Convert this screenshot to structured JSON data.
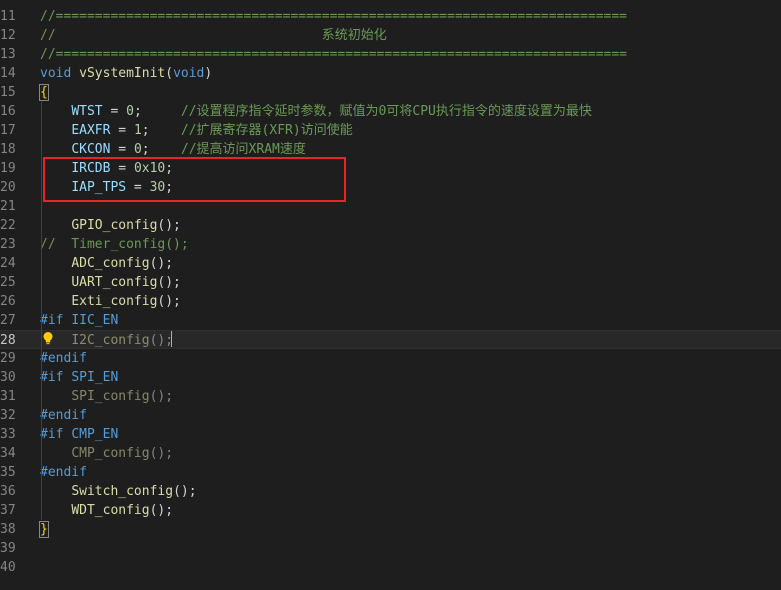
{
  "editor": {
    "highlight_color": "#e8242a",
    "lines": [
      {
        "no": "11",
        "segments": [
          {
            "t": "//=========================================================================",
            "c": "cmt"
          }
        ]
      },
      {
        "no": "12",
        "segments": [
          {
            "t": "//                                  系统初始化",
            "c": "cmt"
          }
        ]
      },
      {
        "no": "13",
        "segments": [
          {
            "t": "//=========================================================================",
            "c": "cmt"
          }
        ]
      },
      {
        "no": "14",
        "segments": [
          {
            "t": "void",
            "c": "kw"
          },
          {
            "t": " ",
            "c": "op"
          },
          {
            "t": "vSystemInit",
            "c": "fn"
          },
          {
            "t": "(",
            "c": "op"
          },
          {
            "t": "void",
            "c": "kw"
          },
          {
            "t": ")",
            "c": "op"
          }
        ]
      },
      {
        "no": "15",
        "segments": [
          {
            "t": "{",
            "c": "bracket"
          }
        ]
      },
      {
        "no": "16",
        "segments": [
          {
            "t": "    ",
            "c": "op"
          },
          {
            "t": "WTST",
            "c": "var"
          },
          {
            "t": " = ",
            "c": "op"
          },
          {
            "t": "0",
            "c": "num"
          },
          {
            "t": ";     ",
            "c": "op"
          },
          {
            "t": "//设置程序指令延时参数，赋值为0可将CPU执行指令的速度设置为最快",
            "c": "cmt"
          }
        ]
      },
      {
        "no": "17",
        "segments": [
          {
            "t": "    ",
            "c": "op"
          },
          {
            "t": "EAXFR",
            "c": "var"
          },
          {
            "t": " = ",
            "c": "op"
          },
          {
            "t": "1",
            "c": "num"
          },
          {
            "t": ";    ",
            "c": "op"
          },
          {
            "t": "//扩展寄存器(XFR)访问使能",
            "c": "cmt"
          }
        ]
      },
      {
        "no": "18",
        "segments": [
          {
            "t": "    ",
            "c": "op"
          },
          {
            "t": "CKCON",
            "c": "var"
          },
          {
            "t": " = ",
            "c": "op"
          },
          {
            "t": "0",
            "c": "num"
          },
          {
            "t": ";    ",
            "c": "op"
          },
          {
            "t": "//提高访问XRAM速度",
            "c": "cmt"
          }
        ]
      },
      {
        "no": "19",
        "segments": [
          {
            "t": "    ",
            "c": "op"
          },
          {
            "t": "IRCDB",
            "c": "var"
          },
          {
            "t": " = ",
            "c": "op"
          },
          {
            "t": "0x10",
            "c": "num"
          },
          {
            "t": ";",
            "c": "op"
          }
        ]
      },
      {
        "no": "20",
        "segments": [
          {
            "t": "    ",
            "c": "op"
          },
          {
            "t": "IAP_TPS",
            "c": "var"
          },
          {
            "t": " = ",
            "c": "op"
          },
          {
            "t": "30",
            "c": "num"
          },
          {
            "t": ";",
            "c": "op"
          }
        ]
      },
      {
        "no": "21",
        "segments": []
      },
      {
        "no": "22",
        "segments": [
          {
            "t": "    ",
            "c": "op"
          },
          {
            "t": "GPIO_config",
            "c": "fn"
          },
          {
            "t": "();",
            "c": "op"
          }
        ]
      },
      {
        "no": "23",
        "segments": [
          {
            "t": "//  Timer_config();",
            "c": "cmt"
          }
        ]
      },
      {
        "no": "24",
        "segments": [
          {
            "t": "    ",
            "c": "op"
          },
          {
            "t": "ADC_config",
            "c": "fn"
          },
          {
            "t": "();",
            "c": "op"
          }
        ]
      },
      {
        "no": "25",
        "segments": [
          {
            "t": "    ",
            "c": "op"
          },
          {
            "t": "UART_config",
            "c": "fn"
          },
          {
            "t": "();",
            "c": "op"
          }
        ]
      },
      {
        "no": "26",
        "segments": [
          {
            "t": "    ",
            "c": "op"
          },
          {
            "t": "Exti_config",
            "c": "fn"
          },
          {
            "t": "();",
            "c": "op"
          }
        ]
      },
      {
        "no": "27",
        "segments": [
          {
            "t": "#if",
            "c": "kw"
          },
          {
            "t": " ",
            "c": "op"
          },
          {
            "t": "IIC_EN",
            "c": "macro"
          }
        ]
      },
      {
        "no": "28",
        "current": true,
        "segments": [
          {
            "t": "    ",
            "c": "op"
          },
          {
            "t": "I2C_config",
            "c": "fn inactive"
          },
          {
            "t": "();",
            "c": "op inactive"
          }
        ]
      },
      {
        "no": "29",
        "segments": [
          {
            "t": "#endif",
            "c": "kw"
          }
        ]
      },
      {
        "no": "30",
        "segments": [
          {
            "t": "#if",
            "c": "kw"
          },
          {
            "t": " ",
            "c": "op"
          },
          {
            "t": "SPI_EN",
            "c": "macro"
          }
        ]
      },
      {
        "no": "31",
        "segments": [
          {
            "t": "    ",
            "c": "op"
          },
          {
            "t": "SPI_config",
            "c": "fn inactive"
          },
          {
            "t": "();",
            "c": "op inactive"
          }
        ]
      },
      {
        "no": "32",
        "segments": [
          {
            "t": "#endif",
            "c": "kw"
          }
        ]
      },
      {
        "no": "33",
        "segments": [
          {
            "t": "#if",
            "c": "kw"
          },
          {
            "t": " ",
            "c": "op"
          },
          {
            "t": "CMP_EN",
            "c": "macro"
          }
        ]
      },
      {
        "no": "34",
        "segments": [
          {
            "t": "    ",
            "c": "op"
          },
          {
            "t": "CMP_config",
            "c": "fn inactive"
          },
          {
            "t": "();",
            "c": "op inactive"
          }
        ]
      },
      {
        "no": "35",
        "segments": [
          {
            "t": "#endif",
            "c": "kw"
          }
        ]
      },
      {
        "no": "36",
        "segments": [
          {
            "t": "    ",
            "c": "op"
          },
          {
            "t": "Switch_config",
            "c": "fn"
          },
          {
            "t": "();",
            "c": "op"
          }
        ]
      },
      {
        "no": "37",
        "segments": [
          {
            "t": "    ",
            "c": "op"
          },
          {
            "t": "WDT_config",
            "c": "fn"
          },
          {
            "t": "();",
            "c": "op"
          }
        ]
      },
      {
        "no": "38",
        "segments": [
          {
            "t": "}",
            "c": "bracket"
          }
        ]
      },
      {
        "no": "39",
        "segments": []
      },
      {
        "no": "40",
        "segments": []
      }
    ]
  }
}
